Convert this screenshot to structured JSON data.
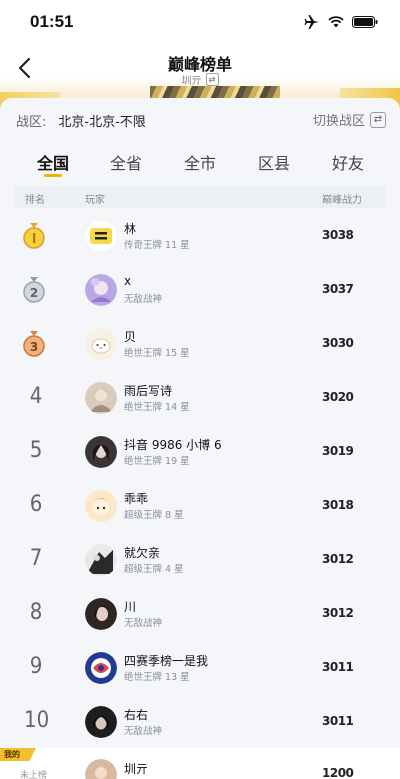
{
  "status_bar": {
    "time": "01:51"
  },
  "nav": {
    "title": "巅峰榜单",
    "subtitle": "圳亓"
  },
  "zone": {
    "label": "战区:",
    "value": "北京-北京-不限",
    "switch_label": "切换战区"
  },
  "tabs": [
    {
      "label": "全国",
      "active": true
    },
    {
      "label": "全省",
      "active": false
    },
    {
      "label": "全市",
      "active": false
    },
    {
      "label": "区县",
      "active": false
    },
    {
      "label": "好友",
      "active": false
    }
  ],
  "columns": {
    "rank": "排名",
    "player": "玩家",
    "power": "巅峰战力"
  },
  "rows": [
    {
      "rank": "1",
      "name": "林",
      "title": "传奇王牌 11 星",
      "score": "3038",
      "medal": "gold",
      "avatar_color": "#f6d948"
    },
    {
      "rank": "2",
      "name": "x",
      "title": "无敌战神",
      "score": "3037",
      "medal": "silver",
      "avatar_color": "#b9a7e6"
    },
    {
      "rank": "3",
      "name": "贝",
      "title": "绝世王牌 15 星",
      "score": "3030",
      "medal": "bronze",
      "avatar_color": "#f7f1e6"
    },
    {
      "rank": "4",
      "name": "雨后写诗",
      "title": "绝世王牌 14 星",
      "score": "3020",
      "avatar_color": "#c7b7a8"
    },
    {
      "rank": "5",
      "name": "抖音 9986 小博 6",
      "title": "绝世王牌 19 星",
      "score": "3019",
      "avatar_color": "#3b3434"
    },
    {
      "rank": "6",
      "name": "乖乖",
      "title": "超级王牌 8 星",
      "score": "3018",
      "avatar_color": "#f3d39c"
    },
    {
      "rank": "7",
      "name": "就欠亲",
      "title": "超级王牌 4 星",
      "score": "3012",
      "avatar_color": "#2a2a2a"
    },
    {
      "rank": "8",
      "name": "川",
      "title": "无敌战神",
      "score": "3012",
      "avatar_color": "#3a2e2a"
    },
    {
      "rank": "9",
      "name": "四赛季榜一是我",
      "title": "绝世王牌 13 星",
      "score": "3011",
      "avatar_color": "#2b3a8f"
    },
    {
      "rank": "10",
      "name": "右右",
      "title": "无敌战神",
      "score": "3011",
      "avatar_color": "#1e1e1e"
    }
  ],
  "my_rank": {
    "tag": "我的",
    "status": "未上榜",
    "name": "圳亓",
    "score": "1200",
    "avatar_color": "#d9b8a0"
  },
  "colors": {
    "accent": "#f0b400",
    "gold": "#f3c02c"
  }
}
